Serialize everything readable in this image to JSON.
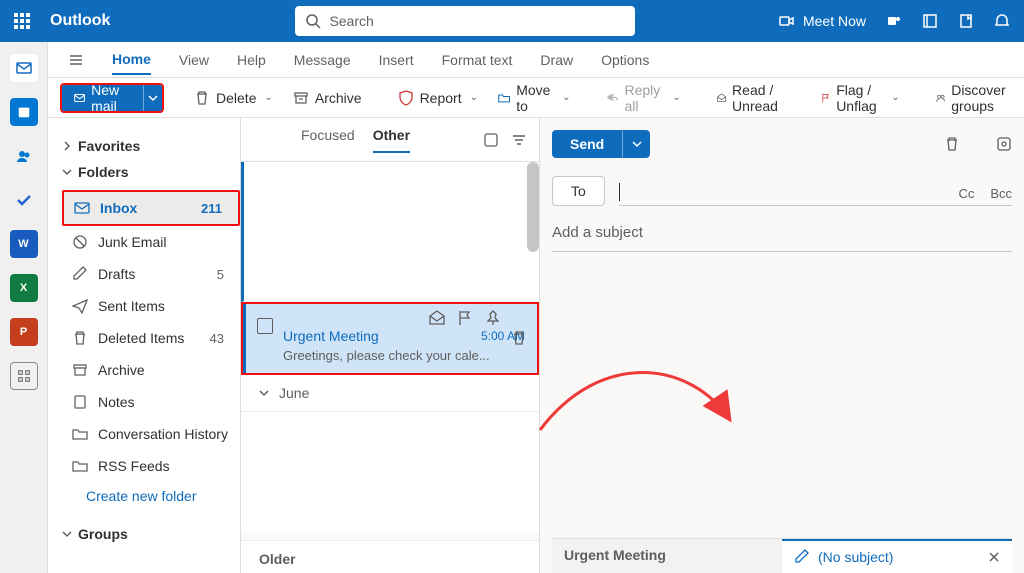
{
  "brand": "Outlook",
  "search": {
    "placeholder": "Search"
  },
  "header": {
    "meet_now": "Meet Now"
  },
  "tabs": {
    "home": "Home",
    "view": "View",
    "help": "Help",
    "message": "Message",
    "insert": "Insert",
    "format": "Format text",
    "draw": "Draw",
    "options": "Options"
  },
  "ribbon": {
    "new_mail": "New mail",
    "delete": "Delete",
    "archive": "Archive",
    "report": "Report",
    "move_to": "Move to",
    "reply_all": "Reply all",
    "read_unread": "Read / Unread",
    "flag_unflag": "Flag / Unflag",
    "discover": "Discover groups"
  },
  "folders": {
    "favorites": "Favorites",
    "folders_label": "Folders",
    "inbox": "Inbox",
    "inbox_count": "211",
    "junk": "Junk Email",
    "drafts": "Drafts",
    "drafts_count": "5",
    "sent": "Sent Items",
    "deleted": "Deleted Items",
    "deleted_count": "43",
    "archive": "Archive",
    "notes": "Notes",
    "conv": "Conversation History",
    "rss": "RSS Feeds",
    "create": "Create new folder",
    "groups": "Groups"
  },
  "list": {
    "focused": "Focused",
    "other": "Other",
    "email_subject": "Urgent Meeting",
    "email_time": "5:00 AM",
    "email_preview": "Greetings, please check your cale...",
    "month": "June",
    "older": "Older"
  },
  "compose": {
    "send": "Send",
    "to": "To",
    "cc": "Cc",
    "bcc": "Bcc",
    "subject_placeholder": "Add a subject",
    "tab1": "Urgent Meeting",
    "tab2": "(No subject)"
  }
}
